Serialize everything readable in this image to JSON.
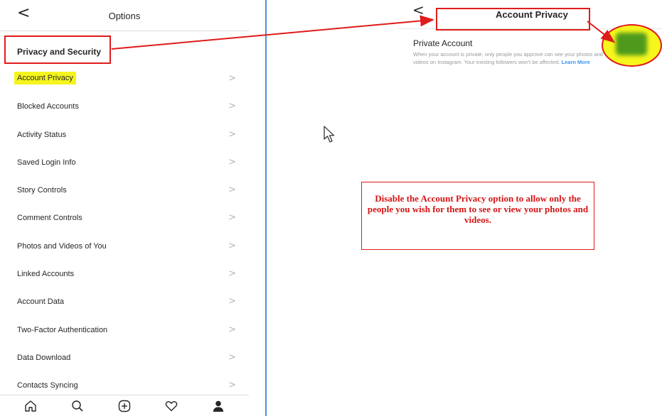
{
  "options_screen": {
    "back_glyph": "<",
    "title": "Options",
    "section_header": "Privacy and Security",
    "chevron_glyph": ">",
    "items": [
      {
        "label": "Account Privacy",
        "highlighted": true
      },
      {
        "label": "Blocked Accounts"
      },
      {
        "label": "Activity Status"
      },
      {
        "label": "Saved Login Info"
      },
      {
        "label": "Story Controls"
      },
      {
        "label": "Comment Controls"
      },
      {
        "label": "Photos and Videos of You"
      },
      {
        "label": "Linked Accounts"
      },
      {
        "label": "Account Data"
      },
      {
        "label": "Two-Factor Authentication"
      },
      {
        "label": "Data Download"
      },
      {
        "label": "Contacts Syncing"
      }
    ],
    "bottom_nav": [
      "home-icon",
      "search-icon",
      "add-post-icon",
      "heart-icon",
      "profile-icon"
    ]
  },
  "account_privacy_screen": {
    "back_glyph": "<",
    "title": "Account Privacy",
    "setting_label": "Private Account",
    "description": "When your account is private, only people you approve can see your photos and videos on Instagram. Your existing followers won't be affected.",
    "learn_more": "Learn More"
  },
  "annotation": {
    "note": "Disable the Account Privacy option to allow only the people you wish for them to see or view your photos and videos."
  },
  "colors": {
    "annotation_red": "#e01b1b",
    "highlight_yellow": "#f5f51e",
    "toggle_green": "#4f9a1c",
    "divider_blue": "#4a90d9",
    "link_blue": "#3897f0"
  }
}
